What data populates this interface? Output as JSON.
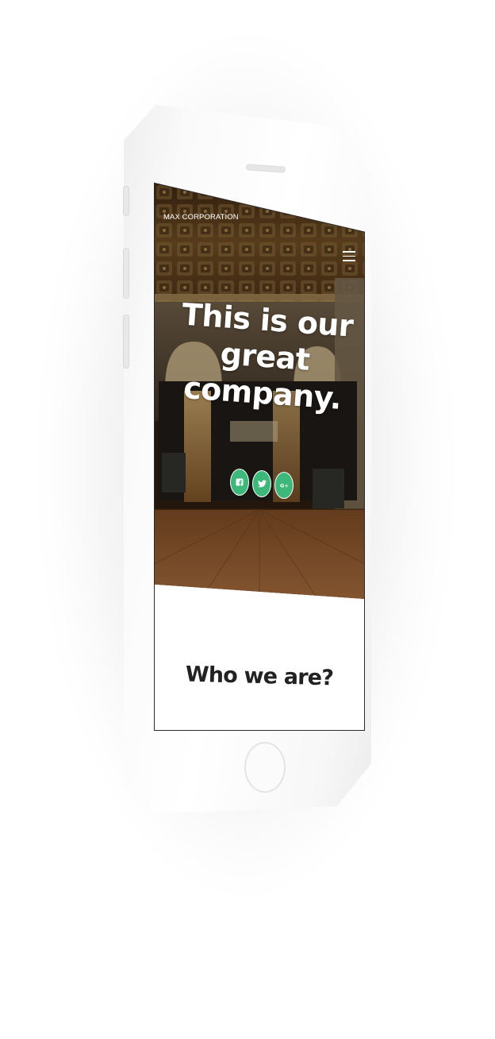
{
  "header": {
    "brand": "MAX CORPORATION",
    "menu_icon": "hamburger-menu-icon"
  },
  "hero": {
    "title_lines": [
      "This is our",
      "great",
      "company."
    ]
  },
  "social": [
    {
      "name": "facebook",
      "icon": "facebook-icon",
      "color": "#3db87a"
    },
    {
      "name": "twitter",
      "icon": "twitter-icon",
      "color": "#3db87a"
    },
    {
      "name": "google-plus",
      "icon": "google-plus-icon",
      "color": "#3db87a"
    }
  ],
  "section": {
    "heading": "Who we are?"
  },
  "colors": {
    "accent": "#3db87a",
    "heading": "#222222",
    "page_background": "#ffffff"
  }
}
